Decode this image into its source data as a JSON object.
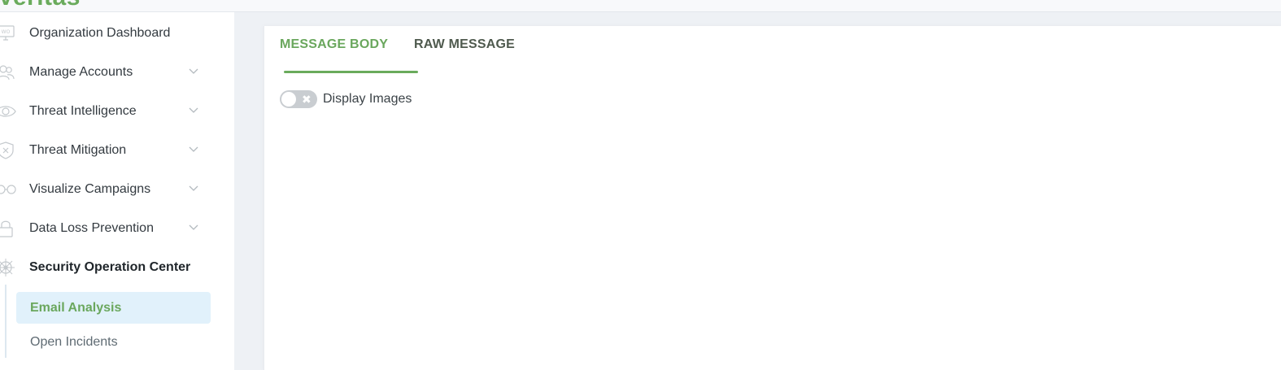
{
  "app": {
    "logo_text": "Veritas"
  },
  "sidebar": {
    "items": [
      {
        "label": "Organization Dashboard",
        "icon": "monitor-icon",
        "expandable": false
      },
      {
        "label": "Manage Accounts",
        "icon": "users-icon",
        "expandable": true
      },
      {
        "label": "Threat Intelligence",
        "icon": "eye-icon",
        "expandable": true
      },
      {
        "label": "Threat Mitigation",
        "icon": "shield-x-icon",
        "expandable": true
      },
      {
        "label": "Visualize Campaigns",
        "icon": "glasses-icon",
        "expandable": true
      },
      {
        "label": "Data Loss Prevention",
        "icon": "lock-icon",
        "expandable": true
      },
      {
        "label": "Security Operation Center",
        "icon": "ship-wheel-icon",
        "expandable": false,
        "active": true
      }
    ],
    "subitems": [
      {
        "label": "Email Analysis",
        "active": true
      },
      {
        "label": "Open Incidents",
        "active": false
      }
    ]
  },
  "main": {
    "tabs": [
      {
        "label": "MESSAGE BODY",
        "active": true
      },
      {
        "label": "RAW MESSAGE",
        "active": false
      }
    ],
    "display_images_toggle": {
      "label": "Display Images",
      "state": "off"
    }
  },
  "colors": {
    "accent_green": "#6aab5c",
    "active_sub_bg": "#e1f1fb",
    "page_bg": "#eef1f5"
  }
}
